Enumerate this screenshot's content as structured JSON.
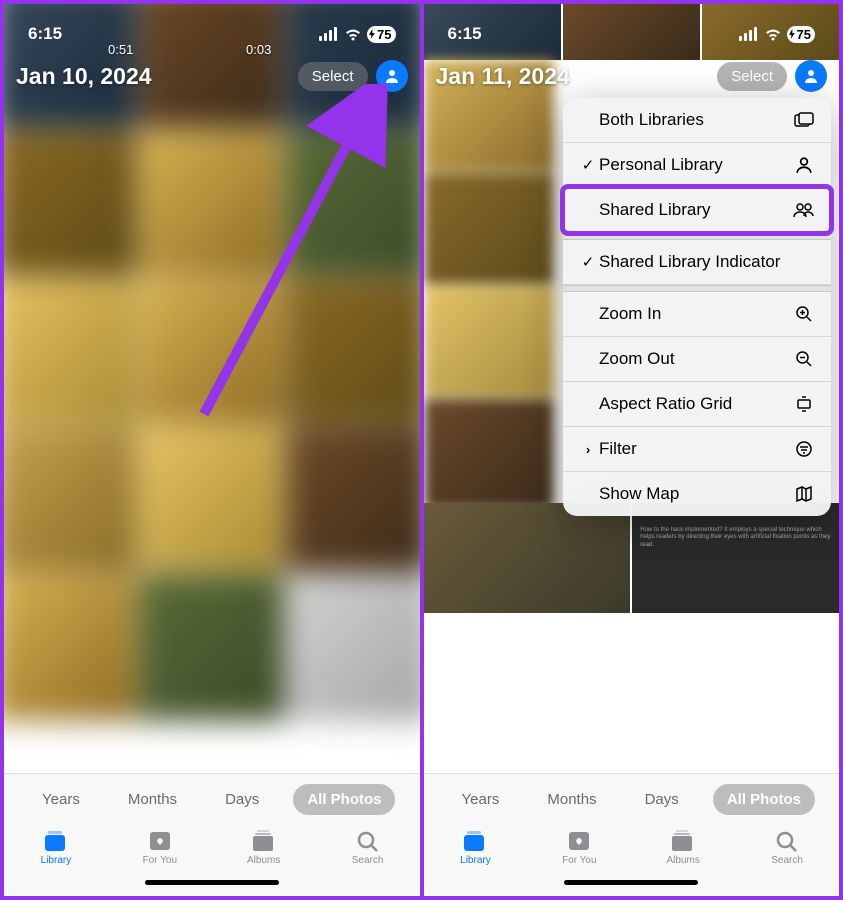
{
  "left": {
    "status": {
      "time": "6:15",
      "battery": "75"
    },
    "header": {
      "date": "Jan 10, 2024",
      "select": "Select"
    },
    "durations": {
      "d1": "0:51",
      "d2": "0:03"
    },
    "segments": {
      "years": "Years",
      "months": "Months",
      "days": "Days",
      "all": "All Photos"
    },
    "tabs": {
      "library": "Library",
      "foryou": "For You",
      "albums": "Albums",
      "search": "Search"
    }
  },
  "right": {
    "status": {
      "time": "6:15",
      "battery": "75"
    },
    "header": {
      "date": "Jan 11, 2024",
      "select": "Select"
    },
    "menu": {
      "both": "Both Libraries",
      "personal": "Personal Library",
      "shared": "Shared Library",
      "indicator": "Shared Library Indicator",
      "zoomin": "Zoom In",
      "zoomout": "Zoom Out",
      "aspect": "Aspect Ratio Grid",
      "filter": "Filter",
      "showmap": "Show Map"
    },
    "segments": {
      "years": "Years",
      "months": "Months",
      "days": "Days",
      "all": "All Photos"
    },
    "tabs": {
      "library": "Library",
      "foryou": "For You",
      "albums": "Albums",
      "search": "Search"
    }
  }
}
